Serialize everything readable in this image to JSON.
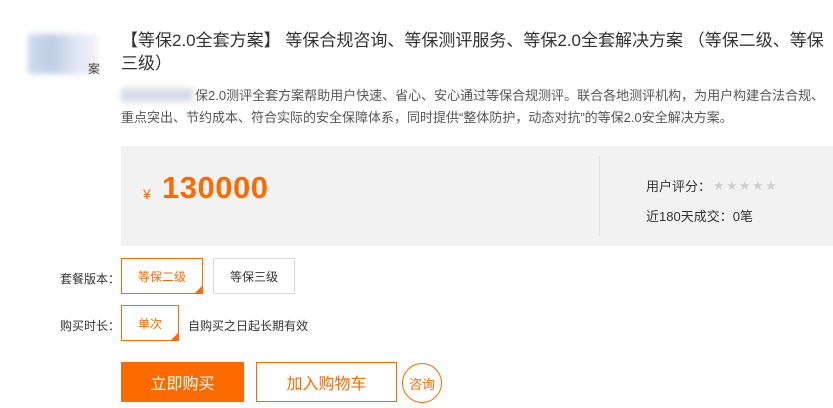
{
  "vendor": {
    "logo_text": "案"
  },
  "product": {
    "title": "【等保2.0全套方案】 等保合规咨询、等保测评服务、等保2.0全套解决方案 （等保二级、等保三级）",
    "description": "保2.0测评全套方案帮助用户快速、省心、安心通过等保合规测评。联合各地测评机构，为用户构建合法合规、重点突出、节约成本、符合实际的安全保障体系，同时提供“整体防护，动态对抗”的等保2.0安全解决方案。"
  },
  "price": {
    "currency_symbol": "¥",
    "value": "130000"
  },
  "stats": {
    "rating_label": "用户评分：",
    "rating_stars": 0,
    "rating_max": 5,
    "sales_text": "近180天成交：0笔"
  },
  "options": {
    "package_label": "套餐版本：",
    "packages": [
      {
        "label": "等保二级",
        "selected": true
      },
      {
        "label": "等保三级",
        "selected": false
      }
    ],
    "duration_label": "购买时长：",
    "durations": [
      {
        "label": "单次",
        "selected": true
      }
    ],
    "duration_note": "自购买之日起长期有效"
  },
  "actions": {
    "buy_label": "立即购买",
    "cart_label": "加入购物车",
    "consult_label": "咨询"
  },
  "colors": {
    "accent": "#ff6a00",
    "price_box_bg": "#f2f2f2",
    "star_inactive": "#cfcfcf"
  }
}
